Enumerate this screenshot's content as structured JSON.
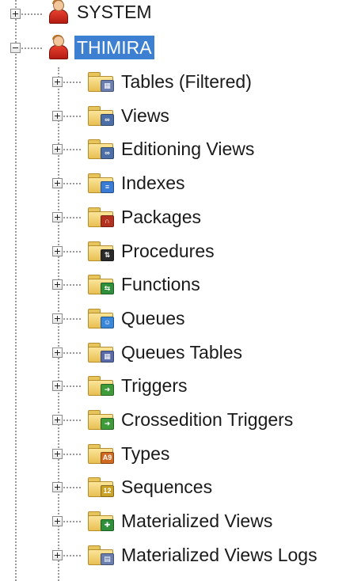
{
  "schema_nodes": [
    {
      "label": "SYSTEM",
      "expanded": false,
      "selected": false,
      "icon": "user-icon"
    },
    {
      "label": "THIMIRA",
      "expanded": true,
      "selected": true,
      "icon": "user-icon"
    }
  ],
  "children": [
    {
      "label": "Tables (Filtered)",
      "icon": "tables-folder-icon",
      "badge_color": "#6a7fb0",
      "badge_glyph": "▦"
    },
    {
      "label": "Views",
      "icon": "views-folder-icon",
      "badge_color": "#4d6fa8",
      "badge_glyph": "∞"
    },
    {
      "label": "Editioning Views",
      "icon": "editioning-views-folder-icon",
      "badge_color": "#4d6fa8",
      "badge_glyph": "∞"
    },
    {
      "label": "Indexes",
      "icon": "indexes-folder-icon",
      "badge_color": "#3a7bd5",
      "badge_glyph": "≡"
    },
    {
      "label": "Packages",
      "icon": "packages-folder-icon",
      "badge_color": "#b2321f",
      "badge_glyph": "∩"
    },
    {
      "label": "Procedures",
      "icon": "procedures-folder-icon",
      "badge_color": "#2a2a2a",
      "badge_glyph": "⇅"
    },
    {
      "label": "Functions",
      "icon": "functions-folder-icon",
      "badge_color": "#2f8f3a",
      "badge_glyph": "⇆"
    },
    {
      "label": "Queues",
      "icon": "queues-folder-icon",
      "badge_color": "#3a86d8",
      "badge_glyph": "☺"
    },
    {
      "label": "Queues Tables",
      "icon": "queues-tables-folder-icon",
      "badge_color": "#5a6aa8",
      "badge_glyph": "▦"
    },
    {
      "label": "Triggers",
      "icon": "triggers-folder-icon",
      "badge_color": "#3f9a3a",
      "badge_glyph": "➜"
    },
    {
      "label": "Crossedition Triggers",
      "icon": "crossedition-triggers-folder-icon",
      "badge_color": "#3f9a3a",
      "badge_glyph": "➜"
    },
    {
      "label": "Types",
      "icon": "types-folder-icon",
      "badge_color": "#d06a22",
      "badge_glyph": "A9"
    },
    {
      "label": "Sequences",
      "icon": "sequences-folder-icon",
      "badge_color": "#c9a227",
      "badge_glyph": "12"
    },
    {
      "label": "Materialized Views",
      "icon": "materialized-views-folder-icon",
      "badge_color": "#2f8f3a",
      "badge_glyph": "✚"
    },
    {
      "label": "Materialized Views Logs",
      "icon": "materialized-views-logs-folder-icon",
      "badge_color": "#6a7fb0",
      "badge_glyph": "▤"
    }
  ]
}
